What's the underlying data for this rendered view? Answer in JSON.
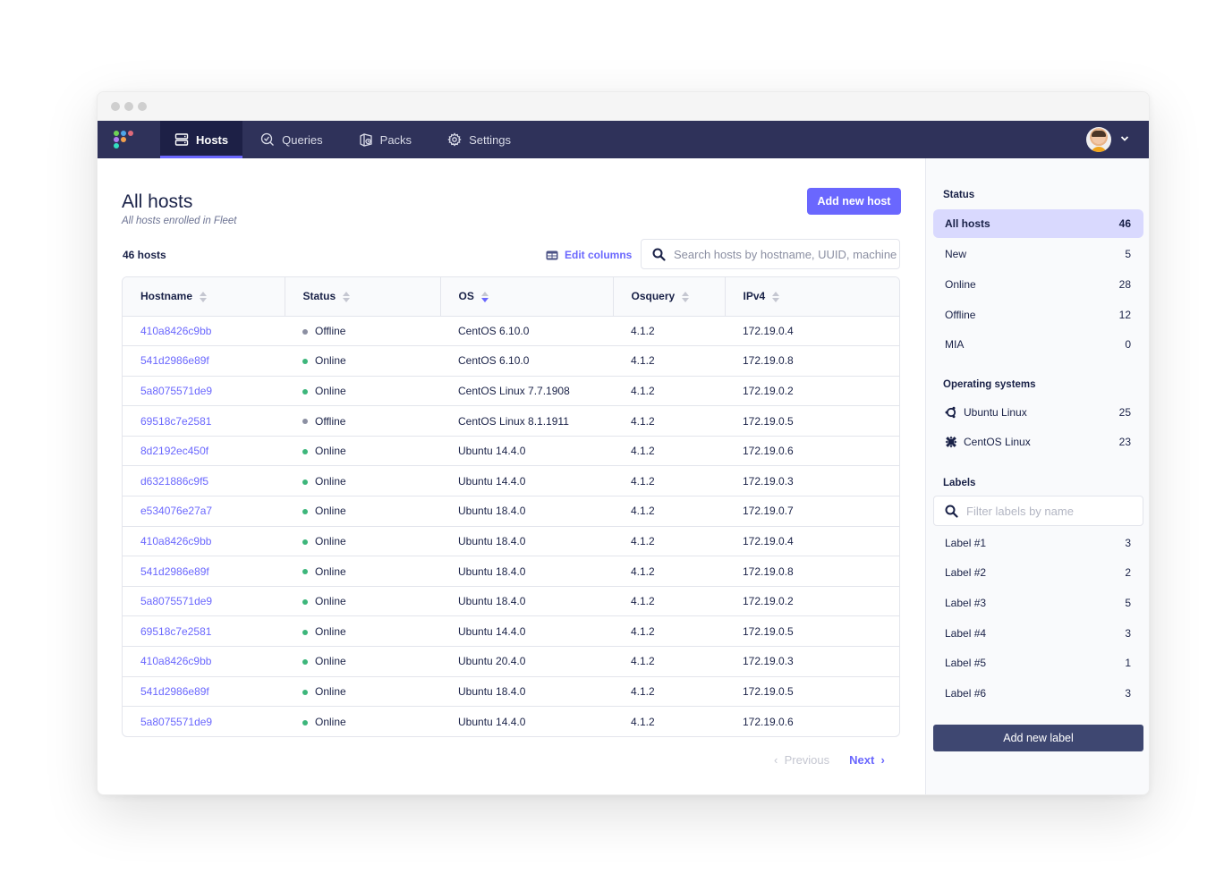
{
  "nav": {
    "logo_dots": [
      "#6fd356",
      "#4fa6e8",
      "#e06a7a",
      "#b27cf0",
      "#f3a14e",
      "#33dfc1"
    ],
    "items": [
      {
        "label": "Hosts",
        "icon": "server-icon",
        "active": true
      },
      {
        "label": "Queries",
        "icon": "query-search-icon",
        "active": false
      },
      {
        "label": "Packs",
        "icon": "packs-icon",
        "active": false
      },
      {
        "label": "Settings",
        "icon": "gear-icon",
        "active": false
      }
    ],
    "user_menu_icon": "chevron-down-icon"
  },
  "header": {
    "title": "All hosts",
    "subtitle": "All hosts enrolled in Fleet",
    "add_host_label": "Add new host",
    "host_count": "46 hosts",
    "edit_columns_label": "Edit columns",
    "search_placeholder": "Search hosts by hostname, UUID, machine serial or IP address"
  },
  "table": {
    "columns": [
      {
        "label": "Hostname",
        "sorted": false
      },
      {
        "label": "Status",
        "sorted": false
      },
      {
        "label": "OS",
        "sorted": true
      },
      {
        "label": "Osquery",
        "sorted": false
      },
      {
        "label": "IPv4",
        "sorted": false
      }
    ],
    "rows": [
      {
        "hostname": "410a8426c9bb",
        "status": "Offline",
        "os": "CentOS 6.10.0",
        "osquery": "4.1.2",
        "ipv4": "172.19.0.4"
      },
      {
        "hostname": "541d2986e89f",
        "status": "Online",
        "os": "CentOS 6.10.0",
        "osquery": "4.1.2",
        "ipv4": "172.19.0.8"
      },
      {
        "hostname": "5a8075571de9",
        "status": "Online",
        "os": "CentOS Linux 7.7.1908",
        "osquery": "4.1.2",
        "ipv4": "172.19.0.2"
      },
      {
        "hostname": "69518c7e2581",
        "status": "Offline",
        "os": "CentOS Linux 8.1.1911",
        "osquery": "4.1.2",
        "ipv4": "172.19.0.5"
      },
      {
        "hostname": "8d2192ec450f",
        "status": "Online",
        "os": "Ubuntu 14.4.0",
        "osquery": "4.1.2",
        "ipv4": "172.19.0.6"
      },
      {
        "hostname": "d6321886c9f5",
        "status": "Online",
        "os": "Ubuntu 14.4.0",
        "osquery": "4.1.2",
        "ipv4": "172.19.0.3"
      },
      {
        "hostname": "e534076e27a7",
        "status": "Online",
        "os": "Ubuntu 18.4.0",
        "osquery": "4.1.2",
        "ipv4": "172.19.0.7"
      },
      {
        "hostname": "410a8426c9bb",
        "status": "Online",
        "os": "Ubuntu 18.4.0",
        "osquery": "4.1.2",
        "ipv4": "172.19.0.4"
      },
      {
        "hostname": "541d2986e89f",
        "status": "Online",
        "os": "Ubuntu 18.4.0",
        "osquery": "4.1.2",
        "ipv4": "172.19.0.8"
      },
      {
        "hostname": "5a8075571de9",
        "status": "Online",
        "os": "Ubuntu 18.4.0",
        "osquery": "4.1.2",
        "ipv4": "172.19.0.2"
      },
      {
        "hostname": "69518c7e2581",
        "status": "Online",
        "os": "Ubuntu 14.4.0",
        "osquery": "4.1.2",
        "ipv4": "172.19.0.5"
      },
      {
        "hostname": "410a8426c9bb",
        "status": "Online",
        "os": "Ubuntu 20.4.0",
        "osquery": "4.1.2",
        "ipv4": "172.19.0.3"
      },
      {
        "hostname": "541d2986e89f",
        "status": "Online",
        "os": "Ubuntu 18.4.0",
        "osquery": "4.1.2",
        "ipv4": "172.19.0.5"
      },
      {
        "hostname": "5a8075571de9",
        "status": "Online",
        "os": "Ubuntu 14.4.0",
        "osquery": "4.1.2",
        "ipv4": "172.19.0.6"
      }
    ],
    "status_colors": {
      "Online": "#3db67b",
      "Offline": "#8b8fa2"
    }
  },
  "pagination": {
    "previous_label": "Previous",
    "next_label": "Next"
  },
  "sidebar": {
    "status_heading": "Status",
    "status_items": [
      {
        "label": "All hosts",
        "count": "46",
        "active": true
      },
      {
        "label": "New",
        "count": "5",
        "active": false
      },
      {
        "label": "Online",
        "count": "28",
        "active": false
      },
      {
        "label": "Offline",
        "count": "12",
        "active": false
      },
      {
        "label": "MIA",
        "count": "0",
        "active": false
      }
    ],
    "os_heading": "Operating systems",
    "os_items": [
      {
        "label": "Ubuntu Linux",
        "count": "25",
        "icon": "ubuntu-icon"
      },
      {
        "label": "CentOS Linux",
        "count": "23",
        "icon": "centos-icon"
      }
    ],
    "labels_heading": "Labels",
    "labels_filter_placeholder": "Filter labels by name",
    "label_items": [
      {
        "label": "Label #1",
        "count": "3"
      },
      {
        "label": "Label #2",
        "count": "2"
      },
      {
        "label": "Label #3",
        "count": "5"
      },
      {
        "label": "Label #4",
        "count": "3"
      },
      {
        "label": "Label #5",
        "count": "1"
      },
      {
        "label": "Label #6",
        "count": "3"
      }
    ],
    "add_label_button": "Add new label"
  },
  "colors": {
    "accent": "#6a67fe",
    "navbar": "#2f325a",
    "navbar_active": "#1d2046",
    "text": "#192147",
    "sidebar_active": "#d9d9fe",
    "secondary_button": "#3e4771"
  }
}
